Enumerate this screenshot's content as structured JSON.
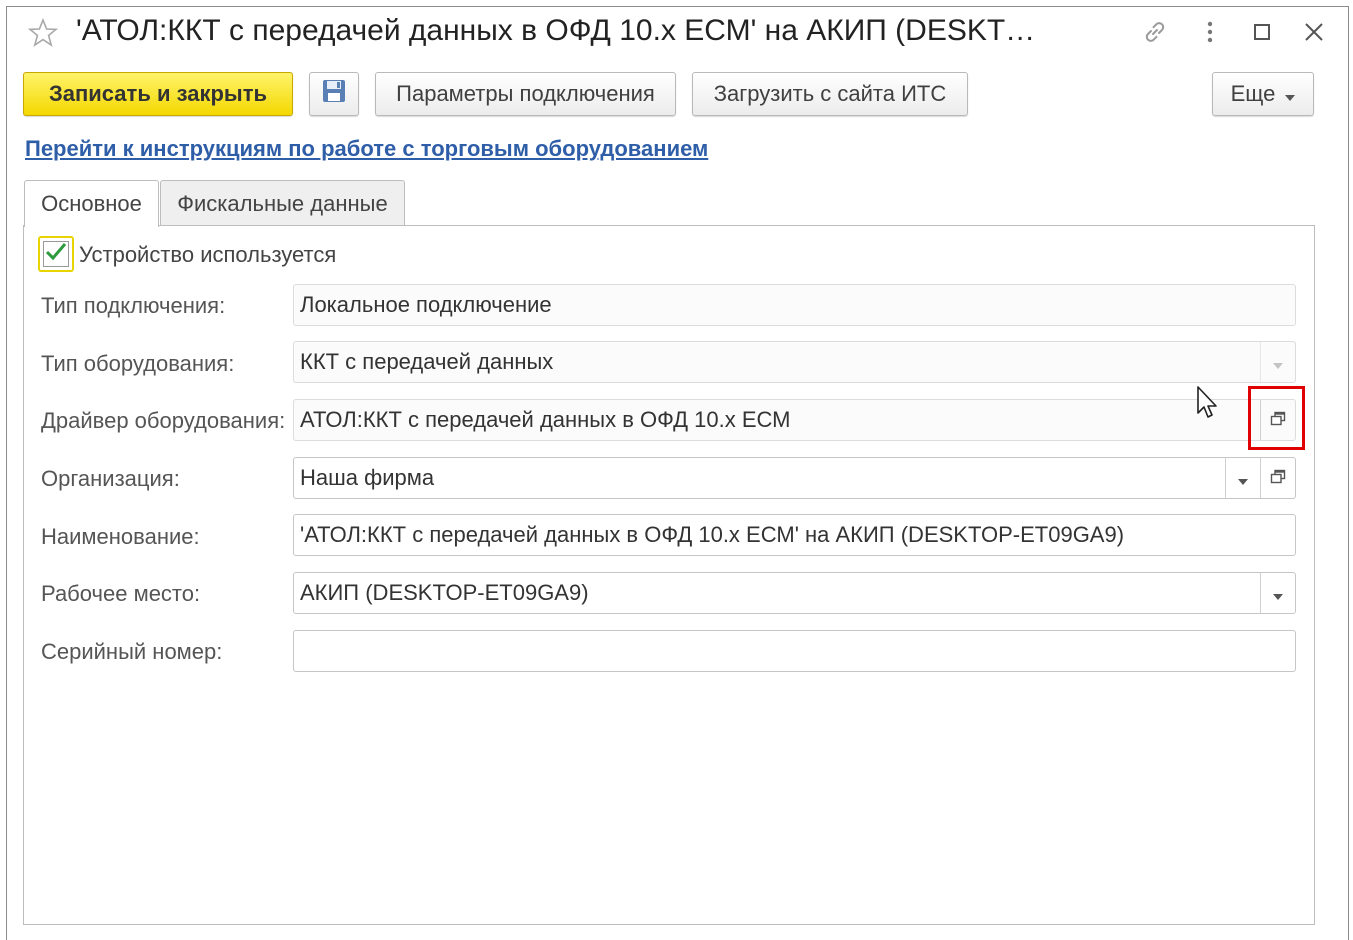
{
  "window": {
    "title": "'АТОЛ:ККТ с передачей данных в ОФД 10.x ЕСМ' на АКИП (DESKT…",
    "icons": [
      "star-icon",
      "link-icon",
      "more-icon",
      "maximize-icon",
      "close-icon"
    ]
  },
  "toolbar": {
    "save_close_label": "Записать и закрыть",
    "save_icon": "floppy-disk-icon",
    "connection_params_label": "Параметры подключения",
    "load_its_label": "Загрузить с сайта ИТС",
    "more_label": "Еще"
  },
  "instructions_link": "Перейти к инструкциям по работе с торговым оборудованием",
  "tabs": [
    {
      "label": "Основное",
      "active": true
    },
    {
      "label": "Фискальные данные",
      "active": false
    }
  ],
  "form": {
    "device_used": {
      "label": "Устройство используется",
      "checked": true
    },
    "connection_type": {
      "label": "Тип подключения:",
      "value": "Локальное подключение"
    },
    "equipment_type": {
      "label": "Тип оборудования:",
      "value": "ККТ с передачей данных"
    },
    "driver": {
      "label": "Драйвер оборудования:",
      "value": "АТОЛ:ККТ с передачей данных в ОФД 10.x ЕСМ"
    },
    "organization": {
      "label": "Организация:",
      "value": "Наша фирма"
    },
    "name": {
      "label": "Наименование:",
      "value": "'АТОЛ:ККТ с передачей данных в ОФД 10.x ЕСМ' на АКИП (DESKTOP-ET09GA9)"
    },
    "workplace": {
      "label": "Рабочее место:",
      "value": "АКИП (DESKTOP-ET09GA9)"
    },
    "serial_number": {
      "label": "Серийный номер:",
      "value": ""
    }
  },
  "colors": {
    "primary_button": "#f4d800",
    "link": "#2f5ea8",
    "highlight": "#e00000",
    "checkmark": "#2e9a3e"
  }
}
